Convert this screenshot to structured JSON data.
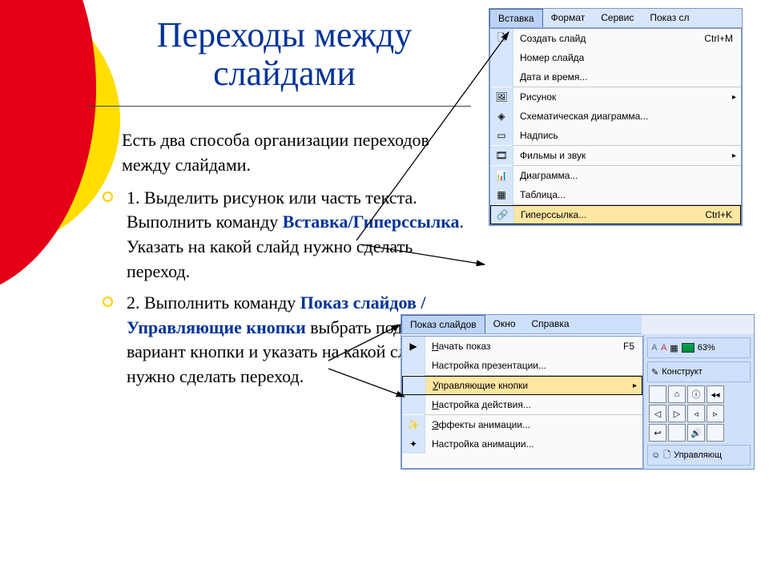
{
  "title": "Переходы между слайдами",
  "intro": "Есть два способа организации переходов между слайдами.",
  "item1_pre": "1. Выделить рисунок или часть текста. Выполнить команду ",
  "item1_cmd": "Вставка/Гиперссылка",
  "item1_post": ". Указать на какой слайд нужно сделать переход.",
  "item2_pre": "2. Выполнить команду ",
  "item2_cmd": "Показ слайдов / Управляющие кнопки",
  "item2_post": " выбрать подходящий вариант кнопки и указать на какой слайд нужно сделать переход.",
  "insert_menu": {
    "tabs": [
      "Вставка",
      "Формат",
      "Сервис",
      "Показ сл"
    ],
    "active": 0,
    "items": [
      {
        "icon": "slide-icon",
        "label": "Создать слайд",
        "shortcut": "Ctrl+M"
      },
      {
        "label": "Номер слайда"
      },
      {
        "label": "Дата и время..."
      },
      {
        "sep": true
      },
      {
        "icon": "picture-icon",
        "label": "Рисунок",
        "submenu": true
      },
      {
        "icon": "diagram-icon",
        "label": "Схематическая диаграмма..."
      },
      {
        "icon": "textbox-icon",
        "label": "Надпись"
      },
      {
        "sep": true
      },
      {
        "icon": "movie-icon",
        "label": "Фильмы и звук",
        "submenu": true
      },
      {
        "sep": true
      },
      {
        "icon": "chart-icon",
        "label": "Диаграмма..."
      },
      {
        "icon": "table-icon",
        "label": "Таблица..."
      },
      {
        "sep": true
      },
      {
        "icon": "link-icon",
        "label": "Гиперссылка...",
        "shortcut": "Ctrl+K",
        "highlight": true
      }
    ]
  },
  "slideshow_menu": {
    "tabs": [
      "Показ слайдов",
      "Окно",
      "Справка"
    ],
    "active": 0,
    "items": [
      {
        "icon": "play-icon",
        "label": "Начать показ",
        "shortcut": "F5",
        "underline": 0
      },
      {
        "label": "Настройка презентации..."
      },
      {
        "sep": true
      },
      {
        "label": "Управляющие кнопки",
        "submenu": true,
        "underline": 0,
        "highlight": true
      },
      {
        "label": "Настройка действия...",
        "underline": 0
      },
      {
        "sep": true
      },
      {
        "icon": "sparkle-icon",
        "label": "Эффекты анимации...",
        "underline": 0
      },
      {
        "icon": "anim-icon",
        "label": "Настройка анимации..."
      }
    ],
    "right_strip": {
      "zoom": "63%",
      "label": "Конструкт"
    },
    "palette_caption": "Управляющ"
  },
  "palette_glyphs": [
    "",
    "⌂",
    "ⓘ",
    "◂◂",
    "◁",
    "▷",
    "◃",
    "▹",
    "↩",
    "",
    "🔊",
    "",
    ""
  ]
}
